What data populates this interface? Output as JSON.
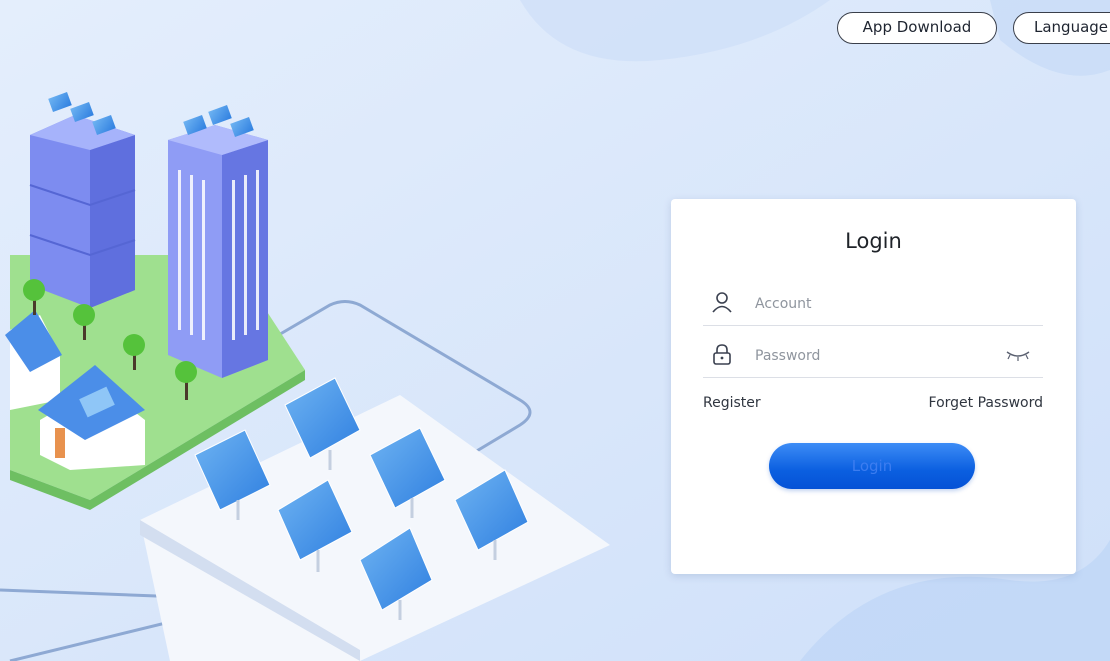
{
  "header": {
    "app_download_label": "App Download",
    "language_label": "Language"
  },
  "login": {
    "title": "Login",
    "account_placeholder": "Account",
    "password_placeholder": "Password",
    "register_label": "Register",
    "forget_password_label": "Forget Password",
    "login_button_label": "Login"
  },
  "colors": {
    "primary": "#0b5fe0",
    "background": "#dbe8fb",
    "card": "#ffffff"
  },
  "icons": {
    "account": "user-icon",
    "password": "lock-icon",
    "visibility": "eye-closed-icon"
  }
}
